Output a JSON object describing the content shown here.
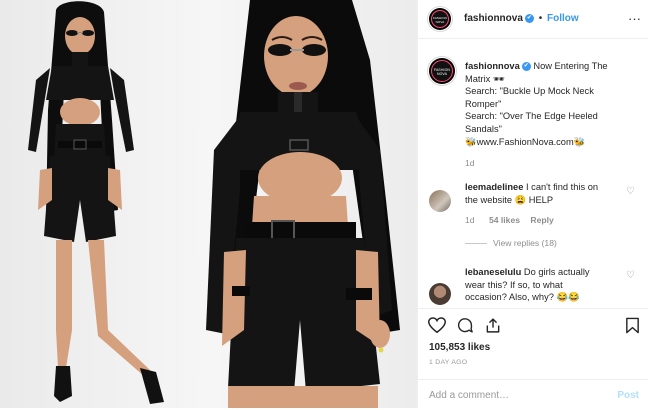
{
  "header": {
    "avatar_logo": "FASHION NOVA",
    "username": "fashionnova",
    "verified_glyph": "✔",
    "separator": "•",
    "follow_label": "Follow",
    "more_glyph": "···"
  },
  "caption": {
    "username": "fashionnova",
    "verified_glyph": "✔",
    "lines": [
      "Now Entering The",
      "Matrix 🕶",
      "Search: \"Buckle Up Mock Neck",
      "Romper\"",
      "Search: \"Over The Edge Heeled",
      "Sandals\"",
      "🐝www.FashionNova.com🐝"
    ],
    "time": "1d"
  },
  "comments": [
    {
      "username": "leemadelinee",
      "lines": [
        "I can't find this on",
        "the website 😩 HELP"
      ],
      "time": "1d",
      "likes": "54 likes",
      "reply_label": "Reply",
      "view_replies": "View replies (18)"
    },
    {
      "username": "lebaneselulu",
      "lines": [
        "Do girls actually",
        "wear this? If so, to what",
        "occasion? Also, why? 😂😂"
      ]
    }
  ],
  "actions": {
    "likes_count": "105,853 likes",
    "timestamp": "1 DAY AGO",
    "comment_placeholder": "Add a comment…",
    "post_label": "Post"
  },
  "icons": [
    "heart-icon",
    "comment-icon",
    "share-icon",
    "bookmark-icon",
    "more-options-icon",
    "verified-badge-icon"
  ],
  "colors": {
    "accent": "#3897f0",
    "post_disabled": "#b2dffc",
    "meta_gray": "#8e8e8e",
    "outfit_black": "#141414"
  }
}
